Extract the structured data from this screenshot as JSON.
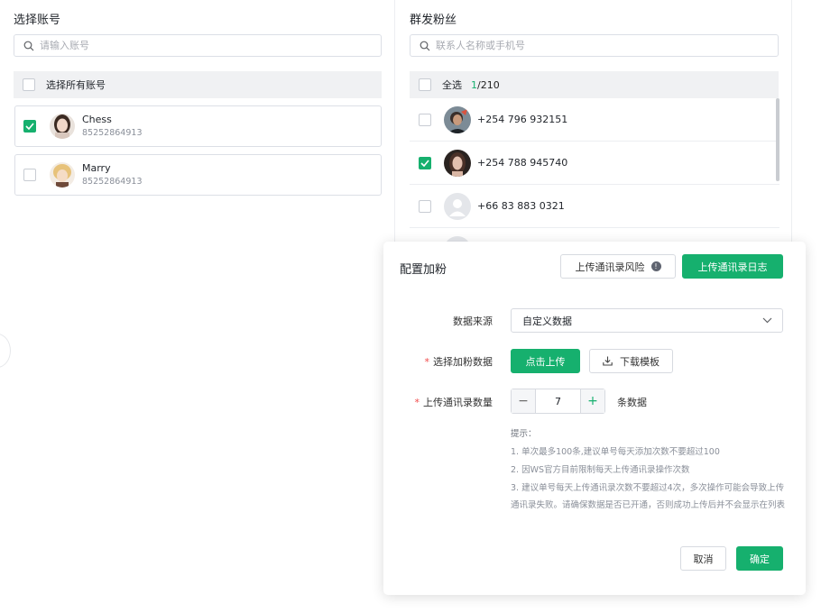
{
  "accounts_panel": {
    "title": "选择账号",
    "search_placeholder": "请输入账号",
    "select_all_label": "选择所有账号",
    "items": [
      {
        "name": "Chess",
        "id": "85252864913",
        "checked": true
      },
      {
        "name": "Marry",
        "id": "85252864913",
        "checked": false
      }
    ]
  },
  "contacts_panel": {
    "title": "群发粉丝",
    "search_placeholder": "联系人名称或手机号",
    "select_all_label": "全选",
    "selected_count": "1",
    "total_count": "/210",
    "items": [
      {
        "phone": "+254 796 932151",
        "checked": false,
        "avatar": "photo-avatar"
      },
      {
        "phone": "+254 788 945740",
        "checked": true,
        "avatar": "photo-avatar"
      },
      {
        "phone": "+66 83 883 0321",
        "checked": false,
        "avatar": "default-avatar"
      }
    ]
  },
  "dialog": {
    "title": "配置加粉",
    "risk_button": "上传通讯录风险",
    "log_button": "上传通讯录日志",
    "source_label": "数据来源",
    "source_value": "自定义数据",
    "data_label": "选择加粉数据",
    "upload_button": "点击上传",
    "template_button": "下载模板",
    "count_label": "上传通讯录数量",
    "count_value": "7",
    "count_unit": "条数据",
    "tips_title": "提示：",
    "tips": [
      "1. 单次最多100条,建议单号每天添加次数不要超过100",
      "2. 因WS官方目前限制每天上传通讯录操作次数",
      "3. 建议单号每天上传通讯录次数不要超过4次，多次操作可能会导致上传通讯录失败。请确保数据是否已开通，否则成功上传后并不会显示在列表"
    ],
    "cancel_button": "取消",
    "confirm_button": "确定"
  },
  "colors": {
    "accent": "#16b06e",
    "required": "#f04a4a"
  }
}
